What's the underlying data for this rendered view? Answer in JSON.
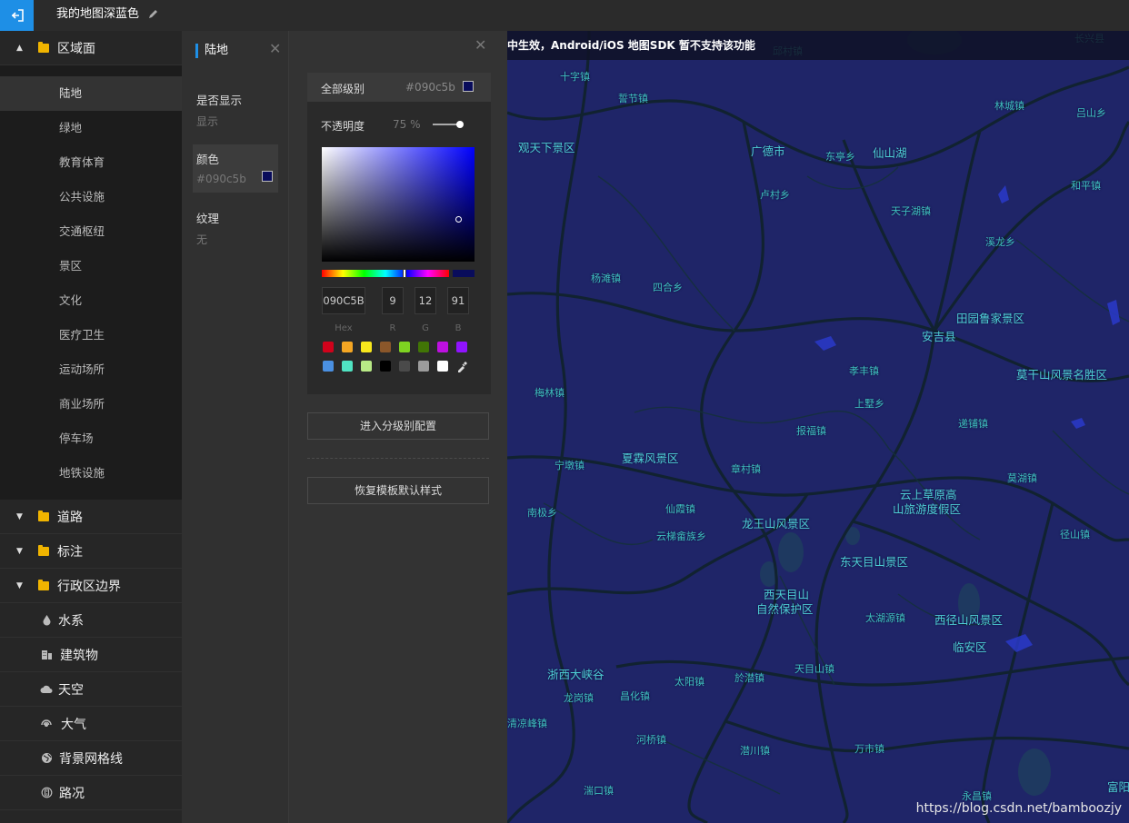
{
  "topbar": {
    "title": "我的地图深蓝色"
  },
  "sidebar": {
    "sections": [
      {
        "label": "区域面",
        "expanded": true
      },
      {
        "label": "道路"
      },
      {
        "label": "标注"
      },
      {
        "label": "行政区边界"
      },
      {
        "label": "水系",
        "icon": "water-drop-icon"
      },
      {
        "label": "建筑物",
        "icon": "building-icon"
      },
      {
        "label": "天空",
        "icon": "cloud-icon"
      },
      {
        "label": "大气",
        "icon": "atmosphere-icon"
      },
      {
        "label": "背景网格线",
        "icon": "globe-icon"
      },
      {
        "label": "路况",
        "icon": "traffic-icon"
      }
    ],
    "sub_items": [
      "陆地",
      "绿地",
      "教育体育",
      "公共设施",
      "交通枢纽",
      "景区",
      "文化",
      "医疗卫生",
      "运动场所",
      "商业场所",
      "停车场",
      "地铁设施"
    ]
  },
  "props": {
    "header": "陆地",
    "visible_label": "是否显示",
    "visible_value": "显示",
    "color_label": "颜色",
    "color_value": "#090c5b",
    "texture_label": "纹理",
    "texture_value": "无"
  },
  "picker": {
    "level_label": "全部级别",
    "level_value": "#090c5b",
    "opacity_label": "不透明度",
    "opacity_value": "75 %",
    "opacity_fraction": 0.75,
    "hex": "090C5B",
    "r": "9",
    "g": "12",
    "b": "91",
    "hex_label": "Hex",
    "r_label": "R",
    "g_label": "G",
    "b_label": "B",
    "presets_row1": [
      "#d0021b",
      "#f5a623",
      "#f8e71c",
      "#8b572a",
      "#7ed321",
      "#417505",
      "#bd10e0",
      "#9013fe"
    ],
    "presets_row2": [
      "#4a90e2",
      "#50e3c2",
      "#b8e986",
      "#000000",
      "#4a4a4a",
      "#9b9b9b",
      "#ffffff"
    ],
    "level_config_button": "进入分级别配置",
    "restore_button": "恢复模板默认样式"
  },
  "map": {
    "notice": "中生效，Android/iOS 地图SDK 暂不支持该功能",
    "places": [
      "邱村镇",
      "长兴县",
      "十字镇",
      "誓节镇",
      "林城镇",
      "吕山乡",
      "观天下景区",
      "广德市",
      "东亭乡",
      "仙山湖",
      "卢村乡",
      "和平镇",
      "天子湖镇",
      "溪龙乡",
      "杨滩镇",
      "四合乡",
      "田园鲁家景区",
      "安吉县",
      "梅林镇",
      "孝丰镇",
      "莫干山风景名胜区",
      "上墅乡",
      "报福镇",
      "递铺镇",
      "宁墩镇",
      "夏霖风景区",
      "章村镇",
      "莫湖镇",
      "云上草原高",
      "山旅游度假区",
      "南极乡",
      "仙霞镇",
      "云梯畲族乡",
      "龙王山风景区",
      "径山镇",
      "东天目山景区",
      "西天目山",
      "自然保护区",
      "太湖源镇",
      "西径山风景区",
      "临安区",
      "浙西大峡谷",
      "太阳镇",
      "於潜镇",
      "天目山镇",
      "龙岗镇",
      "昌化镇",
      "清凉峰镇",
      "河桥镇",
      "潜川镇",
      "万市镇",
      "湍口镇",
      "永昌镇",
      "富阳"
    ],
    "watermark": "https://blog.csdn.net/bamboozjy"
  },
  "colors": {
    "accent": "#1e8fe6",
    "land": "#090c5b",
    "map_bg": "#1f2568",
    "label": "#3fbfbf"
  }
}
